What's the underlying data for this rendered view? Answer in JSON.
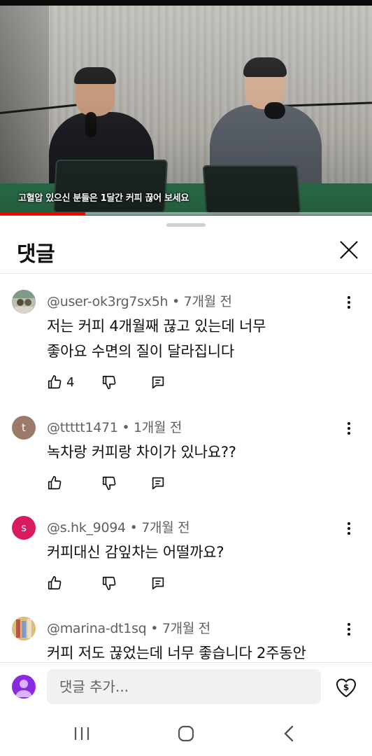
{
  "video": {
    "subtitle": "고혈압 있으신 분들은 1달간 커피 끊어 보세요",
    "progress_fraction": 0.23,
    "progress_color": "#ff0000"
  },
  "sheet": {
    "title": "댓글",
    "close_icon": "close-icon"
  },
  "comments": [
    {
      "author": "@user-ok3rg7sx5h",
      "time": "7개월 전",
      "text_lines": [
        "저는 커피 4개월째 끊고 있는데 너무",
        "좋아요 수면의 질이 달라집니다"
      ],
      "likes": "4",
      "avatar_letter": ""
    },
    {
      "author": "@ttttt1471",
      "time": "1개월 전",
      "text_lines": [
        "녹차랑 커피랑 차이가 있나요??"
      ],
      "likes": "",
      "avatar_letter": "t"
    },
    {
      "author": "@s.hk_9094",
      "time": "7개월 전",
      "text_lines": [
        "커피대신 감잎차는 어떨까요?"
      ],
      "likes": "",
      "avatar_letter": "s"
    },
    {
      "author": "@marina-dt1sq",
      "time": "7개월 전",
      "text_lines": [
        "커피 저도 끊었는데 너무 좋습니다 2주동안"
      ],
      "likes": "",
      "avatar_letter": ""
    }
  ],
  "composer": {
    "placeholder": "댓글 추가...",
    "thanks_icon": "heart-dollar-icon"
  },
  "navbar": {
    "recents_icon": "recents-icon",
    "home_icon": "home-icon",
    "back_icon": "back-icon"
  },
  "colors": {
    "avatar_t": "#9a7b6a",
    "avatar_s": "#d81b60",
    "me_avatar": "#8a2be2"
  }
}
